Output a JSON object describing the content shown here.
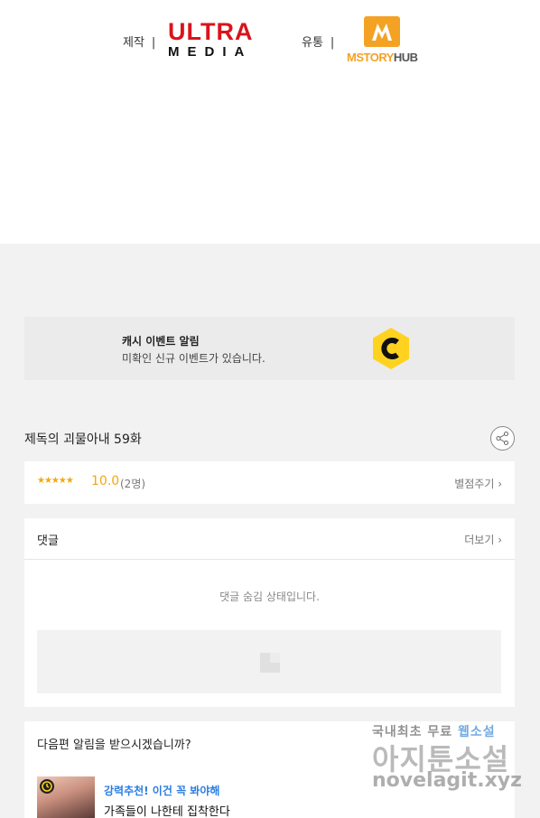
{
  "credits": {
    "production_label": "제작",
    "production_logo": {
      "line1": "ULTRA",
      "line2": "MEDIA"
    },
    "distribution_label": "유통",
    "distribution_logo": {
      "brand": "MSTORY",
      "suffix": "HUB"
    },
    "separator": "|"
  },
  "cash_banner": {
    "title": "캐시 이벤트 알림",
    "subtitle": "미확인 신규 이벤트가 있습니다.",
    "icon": "cash-c-icon"
  },
  "episode": {
    "title": "제독의 괴물아내 59화",
    "share_icon": "share-icon"
  },
  "rating": {
    "stars": "★★★★★",
    "score": "10.0",
    "count": "(2명)",
    "rate_button": "별점주기 ›"
  },
  "comments": {
    "title": "댓글",
    "more_button": "더보기 ›",
    "hidden_message": "댓글 숨김 상태입니다."
  },
  "notify": {
    "question": "다음편 알림을 받으시겠습니까?",
    "recommendation": {
      "tag": "강력추천! 이건 꼭 봐야해",
      "title": "가족들이 나한테 집착한다"
    }
  },
  "watermark": {
    "line1_prefix": "국내최초 무료 ",
    "line1_highlight": "웹소설",
    "line2": "아지툰소설",
    "line3": "novelagit.xyz"
  },
  "colors": {
    "ultra_red": "#d9141c",
    "mstory_orange": "#f4a224",
    "star_yellow": "#f3a712",
    "tag_blue": "#2a7de1",
    "cash_yellow": "#ffd21f"
  }
}
